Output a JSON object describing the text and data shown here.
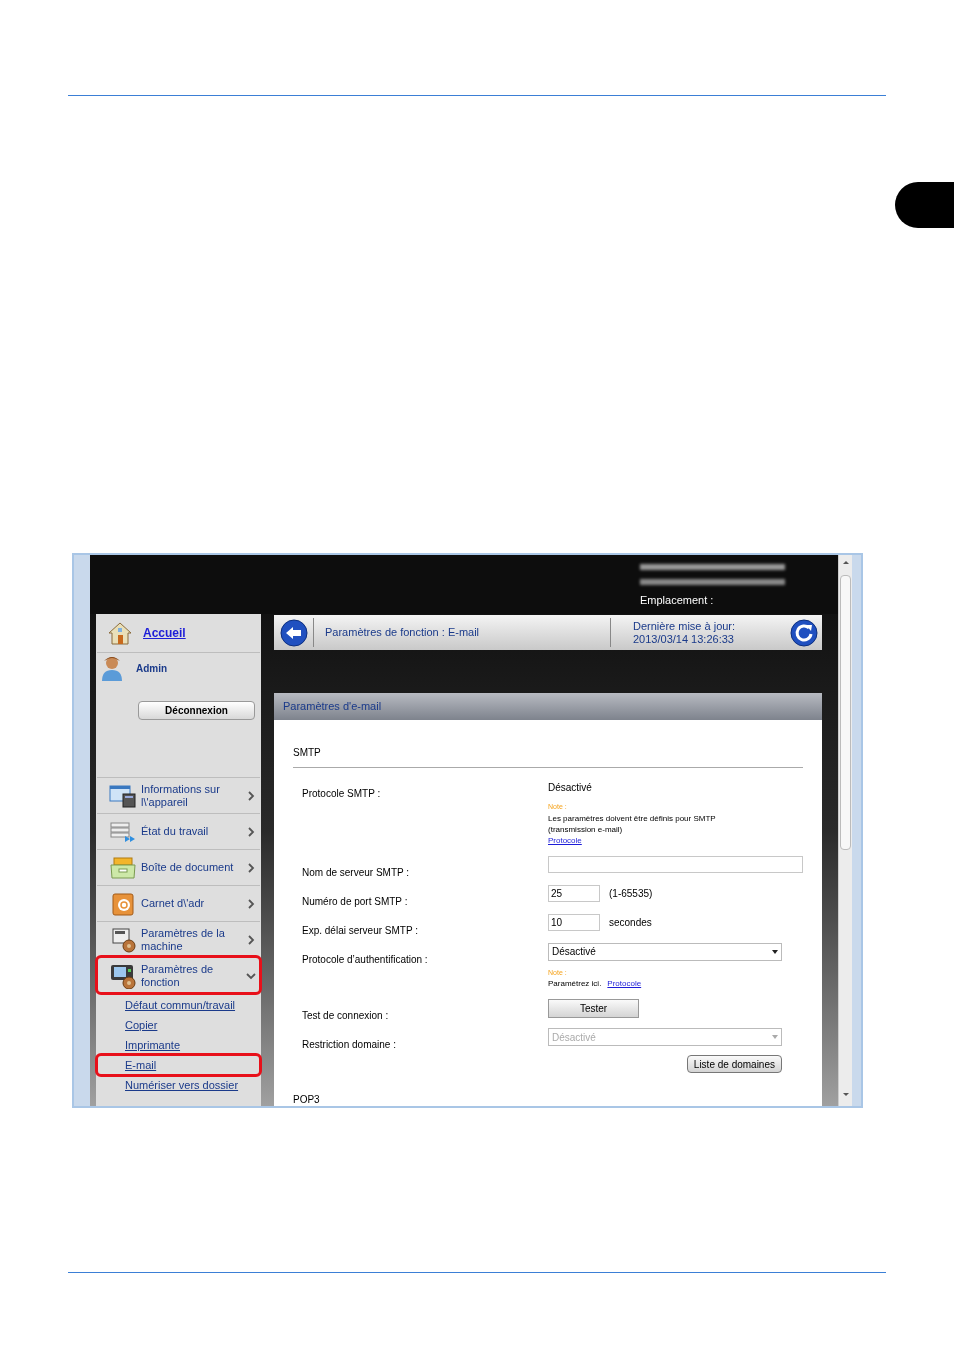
{
  "header": {
    "location_label": "Emplacement :"
  },
  "sidebar": {
    "home": "Accueil",
    "user": "Admin",
    "logout_button": "Déconnexion",
    "items": [
      {
        "label": "Informations sur l\\'appareil",
        "kind": "info",
        "expanded": false,
        "highlighted": false
      },
      {
        "label": "État du travail",
        "kind": "jobs",
        "expanded": false,
        "highlighted": false
      },
      {
        "label": "Boîte de document",
        "kind": "box",
        "expanded": false,
        "highlighted": false
      },
      {
        "label": "Carnet d\\'adr",
        "kind": "address",
        "expanded": false,
        "highlighted": false
      },
      {
        "label": "Paramètres de la machine",
        "kind": "machine",
        "expanded": false,
        "highlighted": false
      },
      {
        "label": "Paramètres de fonction",
        "kind": "function",
        "expanded": true,
        "highlighted": true,
        "children": [
          {
            "label": "Défaut commun/travail",
            "highlighted": false
          },
          {
            "label": "Copier",
            "highlighted": false
          },
          {
            "label": "Imprimante",
            "highlighted": false
          },
          {
            "label": "E-mail",
            "highlighted": true
          },
          {
            "label": "Numériser vers dossier",
            "highlighted": false
          }
        ]
      }
    ]
  },
  "breadcrumb": {
    "title": "Paramètres de fonction : E-mail",
    "updated_label": "Dernière mise à jour:",
    "updated_time": "2013/03/14 13:26:33"
  },
  "panel": {
    "title": "Paramètres d'e-mail",
    "sections": [
      {
        "title": "SMTP",
        "rows": [
          {
            "label": "Protocole SMTP :",
            "kind": "text",
            "value": "Désactivé",
            "note": {
              "title": "Note :",
              "text": "Les paramètres doivent être définis pour SMTP (transmission e-mail)",
              "link": "Protocole",
              "inline": false
            }
          },
          {
            "label": "Nom de serveur SMTP :",
            "kind": "input"
          },
          {
            "label": "Numéro de port SMTP :",
            "kind": "input",
            "value": "25",
            "suffix": "(1-65535)"
          },
          {
            "label": "Exp. délai serveur SMTP :",
            "kind": "input",
            "value": "10",
            "suffix": "secondes"
          },
          {
            "label": "Protocole d’authentification :",
            "kind": "select",
            "value": "Désactivé",
            "disabled": false,
            "note": {
              "title": "Note :",
              "text": "Paramétrez ici.",
              "link": "Protocole",
              "inline": true
            }
          },
          {
            "label": "Test de connexion :",
            "kind": "button",
            "value": "Tester"
          },
          {
            "label": "Restriction domaine :",
            "kind": "select",
            "value": "Désactivé",
            "disabled": true,
            "extra_button": "Liste de domaines"
          }
        ]
      },
      {
        "title": "POP3"
      }
    ]
  }
}
